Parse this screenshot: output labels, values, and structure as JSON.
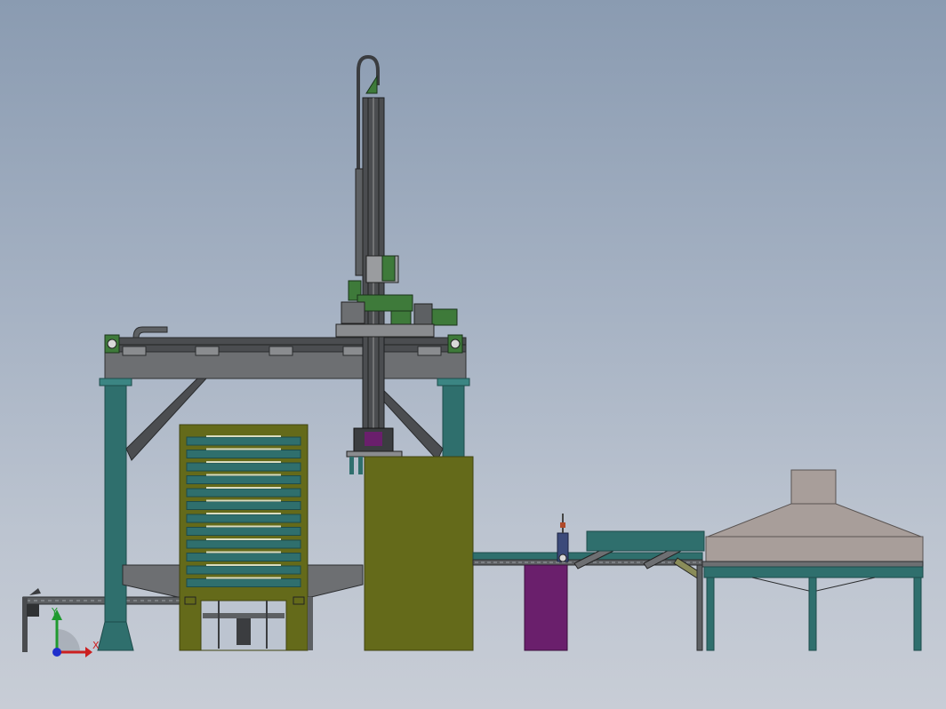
{
  "colors": {
    "teal": "#2f6f6d",
    "teal_dark": "#1d4b4a",
    "olive": "#646a1a",
    "olive_dark": "#3f4310",
    "green": "#3e7a3a",
    "green_dark": "#255225",
    "grey_metal": "#6d6f72",
    "grey_dark": "#3b3d40",
    "purple": "#6a1f6c",
    "hood": "#a89e9a",
    "axis_x": "#cc1f1f",
    "axis_y": "#1f9a2f",
    "axis_z": "#1f2fcc"
  },
  "triad": {
    "x_label": "X",
    "y_label": "Y"
  }
}
